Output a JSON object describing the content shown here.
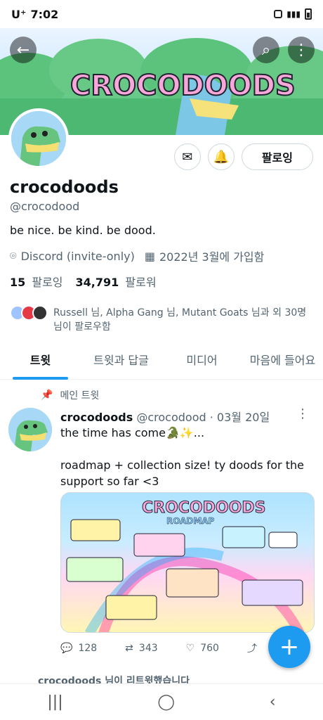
{
  "status": {
    "carrier": "U⁺",
    "time": "7:02"
  },
  "banner": {
    "logo_text": "CROCODOODS"
  },
  "actions": {
    "follow_label": "팔로잉"
  },
  "profile": {
    "name": "crocodoods",
    "handle": "@crocodood",
    "bio": "be nice. be kind. be dood.",
    "location": "Discord (invite-only)",
    "joined": "2022년 3월에 가입함",
    "following_count": "15",
    "following_label": "팔로잉",
    "followers_count": "34,791",
    "followers_label": "팔로워",
    "followers_you_know": "Russell 님, Alpha Gang 님, Mutant Goats 님과 외 30명님이 팔로우함"
  },
  "tabs": [
    "트윗",
    "트윗과 답글",
    "미디어",
    "마음에 들어요"
  ],
  "pinned_label": "메인 트윗",
  "tweet": {
    "name": "crocodoods",
    "handle": "@crocodood",
    "date": "· 03월 20일",
    "line1": "the time has come🐊✨...",
    "line2": "roadmap + collection size! ty doods for the support so far <3",
    "media_title": "CROCODOODS",
    "media_subtitle": "ROADMAP",
    "replies": "128",
    "retweets": "343",
    "likes": "760"
  },
  "next_item": "crocodoods 님이 리트윗했습니다",
  "colors": {
    "accent": "#1d9bf0",
    "muted": "#536471"
  }
}
